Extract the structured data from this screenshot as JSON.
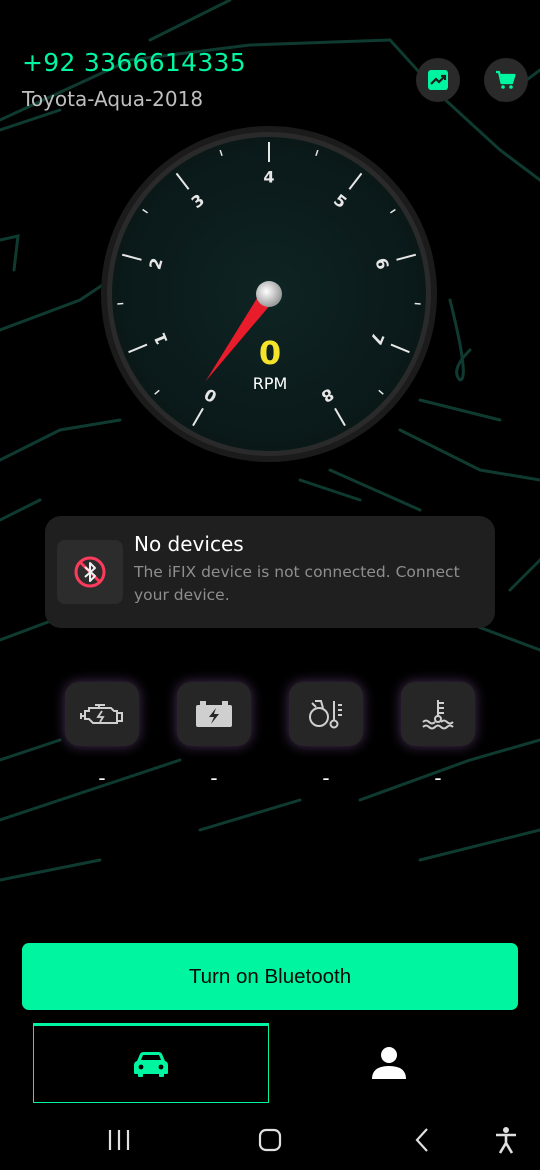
{
  "colors": {
    "accent": "#00f5a0",
    "rpm_value": "#f4e32a",
    "map_lines": "#0f3a30",
    "card": "#1f1f1f",
    "needle": "#e81c2a",
    "bt_off_icon": "#ff3b5c"
  },
  "header": {
    "phone": "+92 3366614335",
    "car_model": "Toyota-Aqua-2018",
    "icons": [
      "chart-trend-icon",
      "cart-icon"
    ]
  },
  "gauge": {
    "ticks": [
      "0",
      "1",
      "2",
      "3",
      "4",
      "5",
      "6",
      "7",
      "8"
    ],
    "value": "0",
    "unit": "RPM",
    "needle_position": 0
  },
  "notice": {
    "icon": "bluetooth-off-icon",
    "title": "No devices",
    "message": "The iFIX device is not connected. Connect your device."
  },
  "sensors": [
    {
      "icon": "engine-icon",
      "value": "-"
    },
    {
      "icon": "battery-icon",
      "value": "-"
    },
    {
      "icon": "oil-temperature-icon",
      "value": "-"
    },
    {
      "icon": "coolant-temperature-icon",
      "value": "-"
    }
  ],
  "bluetooth_button": {
    "label": "Turn on Bluetooth"
  },
  "bottom_tabs": [
    {
      "icon": "car-icon",
      "active": true
    },
    {
      "icon": "person-icon",
      "active": false
    }
  ],
  "system_nav": [
    "recents-icon",
    "home-icon",
    "back-icon",
    "accessibility-icon"
  ]
}
